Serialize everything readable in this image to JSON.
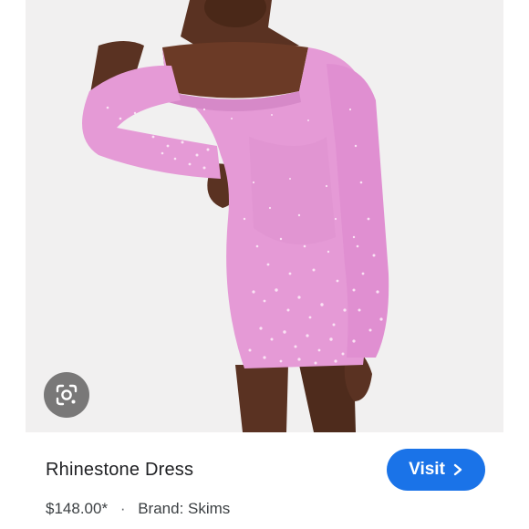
{
  "product": {
    "title": "Rhinestone Dress",
    "price": "$148.00*",
    "separator": "·",
    "brand": "Brand: Skims"
  },
  "actions": {
    "visit_label": "Visit",
    "visit_icon": "chevron-right-icon",
    "lens_icon": "google-lens-icon"
  },
  "colors": {
    "accent": "#1a73e8",
    "dress": "#e59ad6",
    "background": "#f1f0f0"
  }
}
